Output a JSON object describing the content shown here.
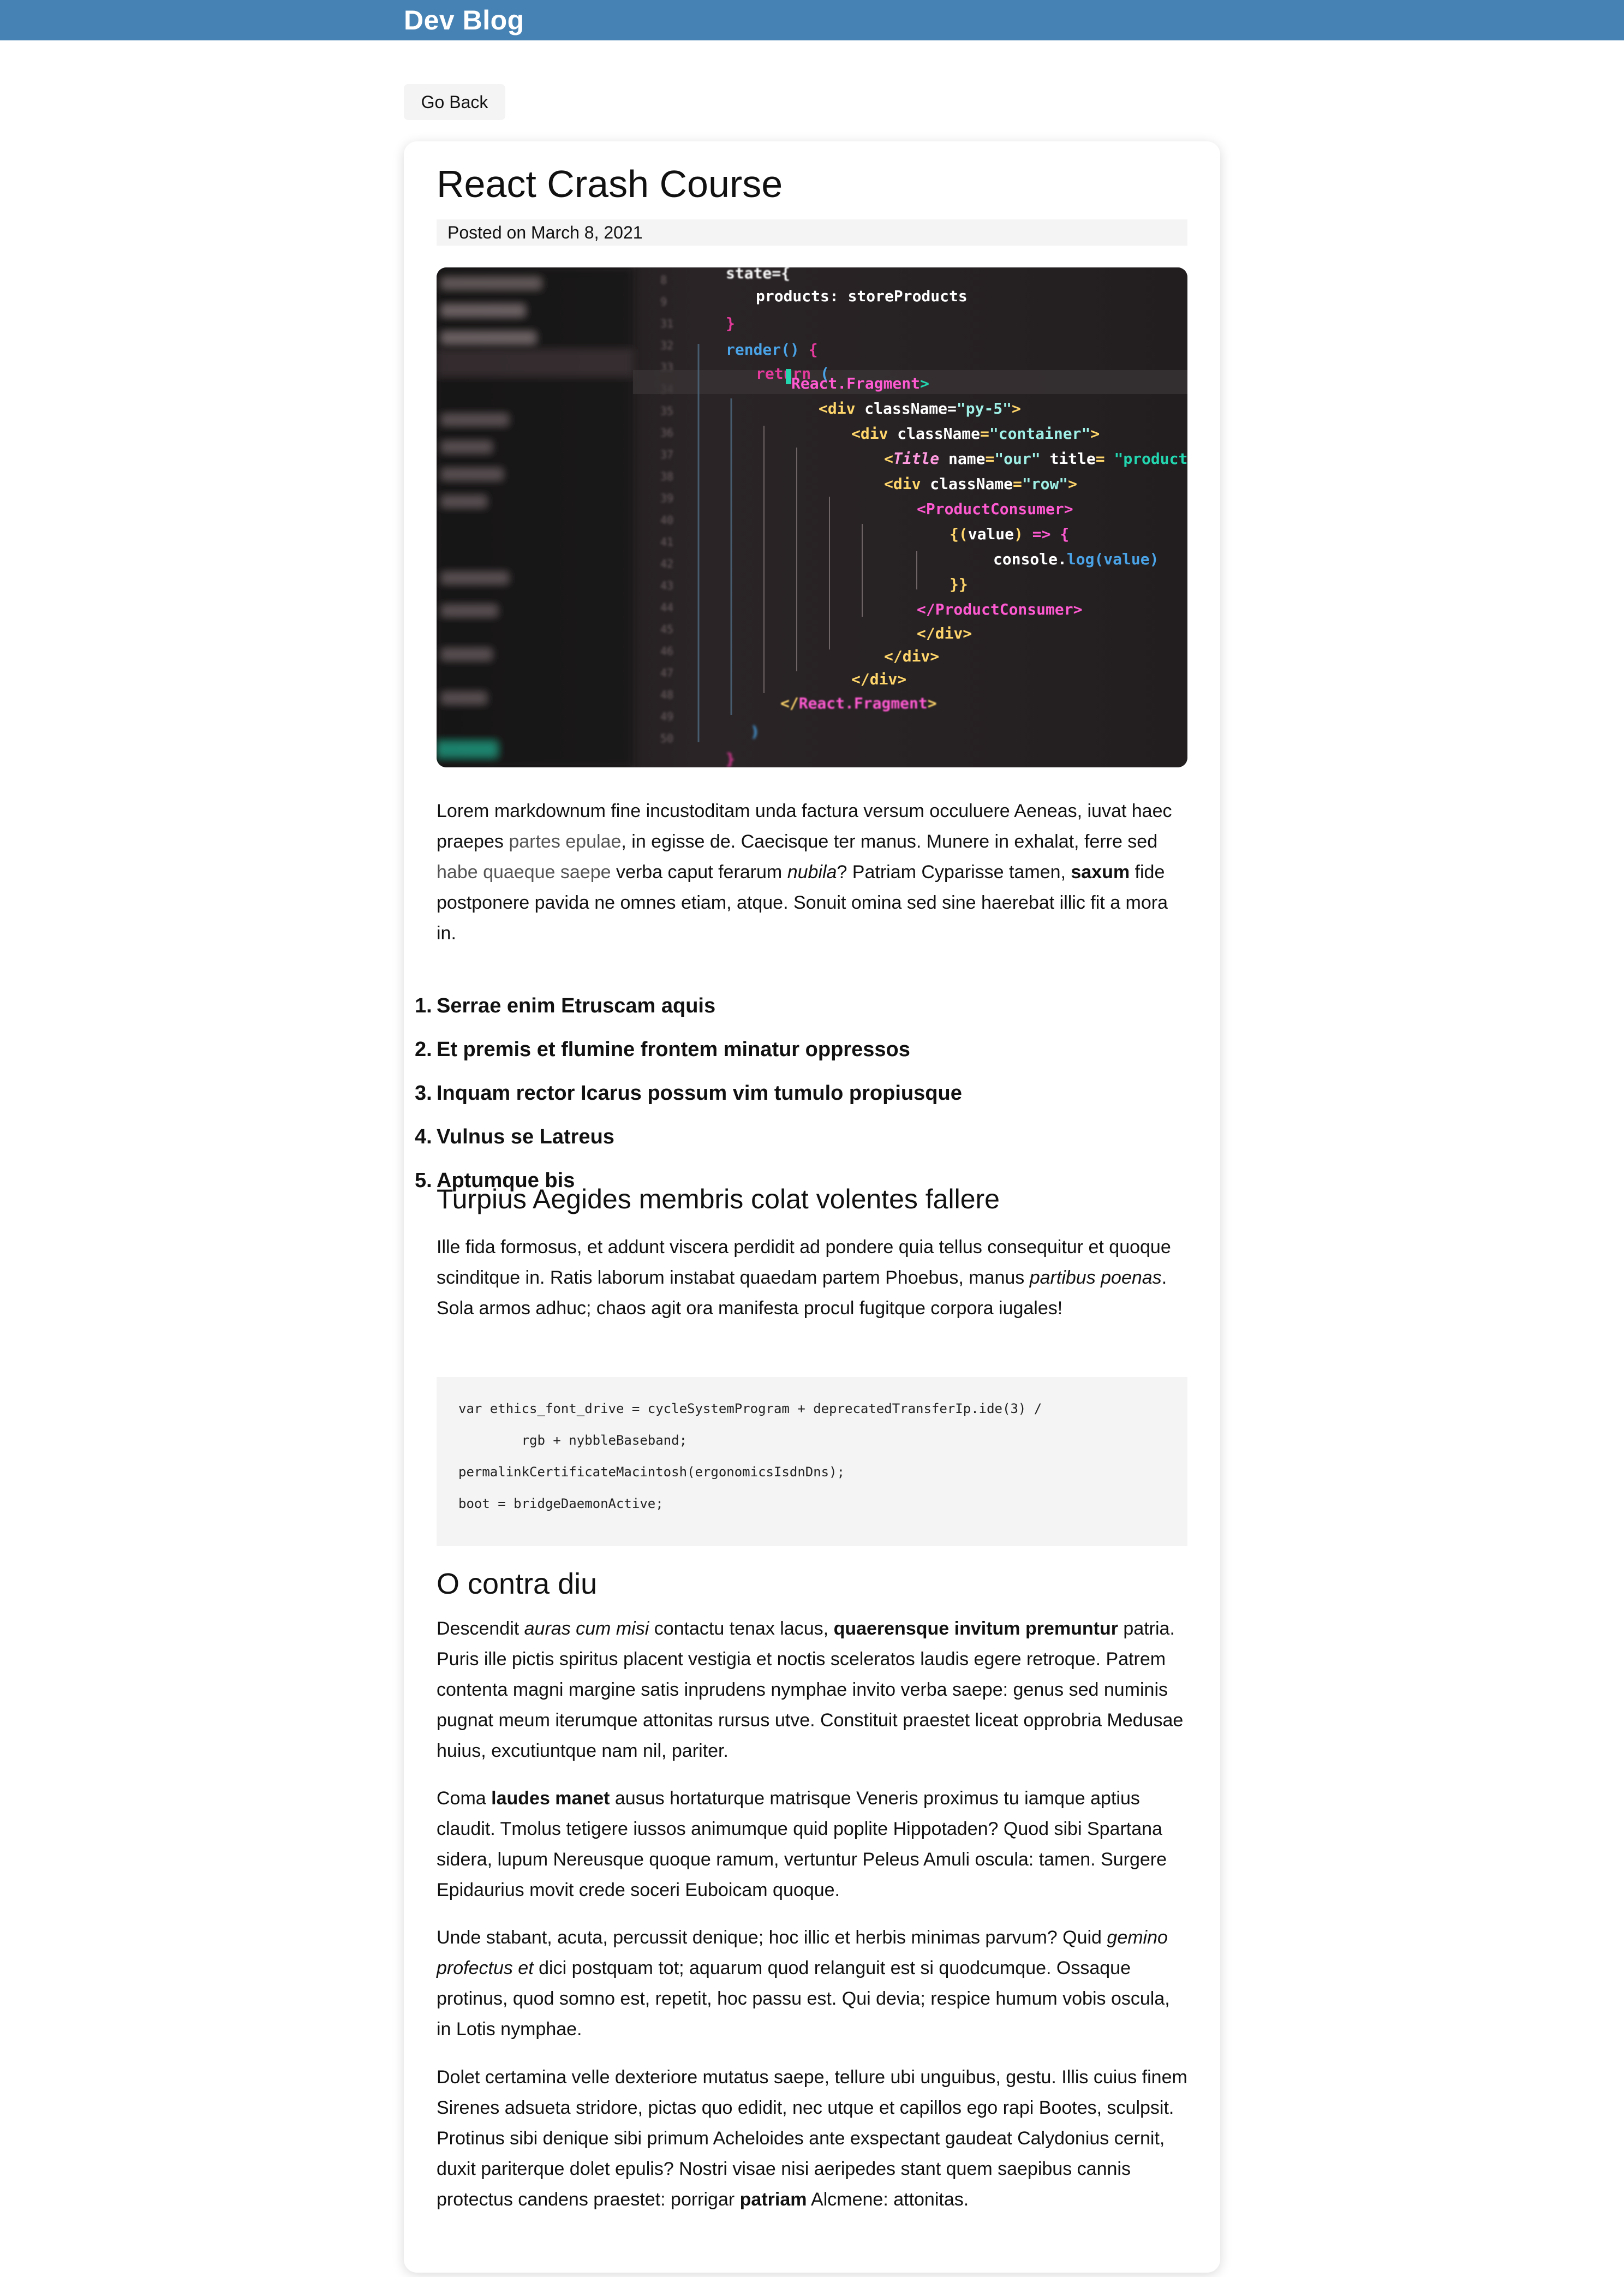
{
  "nav": {
    "brand": "Dev Blog"
  },
  "back_button": "Go Back",
  "post": {
    "title": "React Crash Course",
    "posted": "Posted on March 8, 2021",
    "intro": {
      "t1": "Lorem markdownum fine incustoditam unda factura versum occuluere Aeneas, iuvat haec praepes ",
      "link1": "partes epulae",
      "t2": ", in egisse de. Caecisque ter manus. Munere in exhalat, ferre sed ",
      "link2": "habe quaeque saepe",
      "t3": " verba caput ferarum ",
      "em1": "nubila",
      "t4": "? Patriam Cyparisse tamen, ",
      "b1": "saxum",
      "t5": " fide postponere pavida ne omnes etiam, atque. Sonuit omina sed sine haerebat illic fit a mora in."
    },
    "list": [
      "Serrae enim Etruscam aquis",
      "Et premis et flumine frontem minatur oppressos",
      "Inquam rector Icarus possum vim tumulo propiusque",
      "Vulnus se Latreus",
      "Aptumque bis"
    ],
    "h2_1": "Turpius Aegides membris colat volentes fallere",
    "para2": {
      "t1": "Ille fida formosus, et addunt viscera perdidit ad pondere quia tellus consequitur et quoque scinditque in. Ratis laborum instabat quaedam partem Phoebus, manus ",
      "em1": "partibus poenas",
      "t2": ". Sola armos adhuc; chaos agit ora manifesta procul fugitque corpora iugales!"
    },
    "code": [
      "var ethics_font_drive = cycleSystemProgram + deprecatedTransferIp.ide(3) /",
      "        rgb + nybbleBaseband;",
      "permalinkCertificateMacintosh(ergonomicsIsdnDns);",
      "boot = bridgeDaemonActive;"
    ],
    "h2_2": "O contra diu",
    "para3": {
      "t1": "Descendit ",
      "em1": "auras cum misi",
      "t2": " contactu tenax lacus, ",
      "b1": "quaerensque invitum premuntur",
      "t3": " patria. Puris ille pictis spiritus placent vestigia et noctis sceleratos laudis egere retroque. Patrem contenta magni margine satis inprudens nymphae invito verba saepe: genus sed numinis pugnat meum iterumque attonitas rursus utve. Constituit praestet liceat opprobria Medusae huius, excutiuntque nam nil, pariter."
    },
    "para4": {
      "t1": "Coma ",
      "b1": "laudes manet",
      "t2": " ausus hortaturque matrisque Veneris proximus tu iamque aptius claudit. Tmolus tetigere iussos animumque quid poplite Hippotaden? Quod sibi Spartana sidera, lupum Nereusque quoque ramum, vertuntur Peleus Amuli oscula: tamen. Surgere Epidaurius movit crede soceri Euboicam quoque."
    },
    "para5": {
      "t1": "Unde stabant, acuta, percussit denique; hoc illic et herbis minimas parvum? Quid ",
      "em1": "gemino profectus et",
      "t2": " dici postquam tot; aquarum quod relanguit est si quodcumque. Ossaque protinus, quod somno est, repetit, hoc passu est. Qui devia; respice humum vobis oscula, in Lotis nymphae."
    },
    "para6": {
      "t1": "Dolet certamina velle dexteriore mutatus saepe, tellure ubi unguibus, gestu. Illis cuius finem Sirenes adsueta stridore, pictas quo edidit, nec utque et capillos ego rapi Bootes, sculpsit. Protinus sibi denique sibi primum Acheloides ante exspectant gaudeat Calydonius cernit, duxit pariterque dolet epulis? Nostri visae nisi aeripedes stant quem saepibus cannis protectus candens praestet: porrigar ",
      "b1": "patriam",
      "t2": " Alcmene: attonitas."
    }
  }
}
